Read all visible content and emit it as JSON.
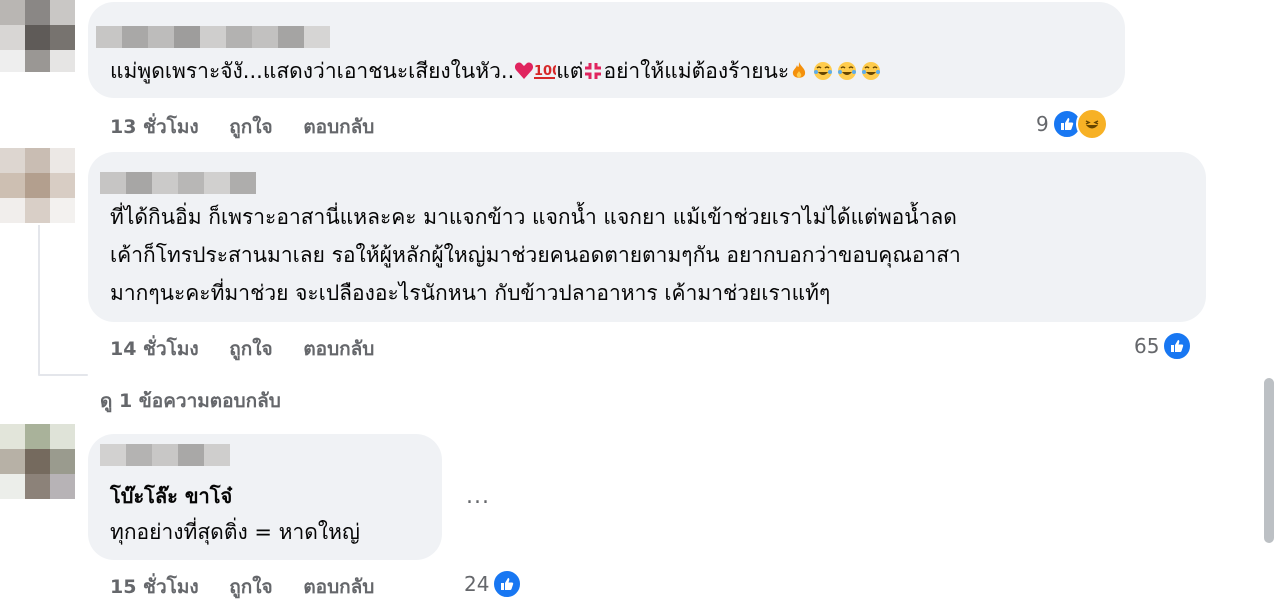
{
  "colors": {
    "bubble": "#f0f2f5",
    "meta_text": "#65676b",
    "like_blue": "#1877f2",
    "haha_yellow": "#f7b125"
  },
  "comments": [
    {
      "text_line_1": "แม่พูดเพราะจังั...แสดงว่าเอาชนะเสียงในหัว..",
      "text_mid": "แต่",
      "text_line_1_end": "อย่าให้แม่ต้องร้ายนะ",
      "time": "13 ชั่วโมง",
      "like": "ถูกใจ",
      "reply": "ตอบกลับ",
      "reaction_count": "9",
      "reaction_icons": [
        "like-icon",
        "haha-icon"
      ]
    },
    {
      "lines": [
        "ที่ได้กินอิ่ม ก็เพราะอาสานี่แหละคะ มาแจกข้าว แจกน้ำ แจกยา แม้เข้าช่วยเราไม่ได้แต่พอน้ำลด",
        "เค้าก็โทรประสานมาเลย รอให้ผู้หลักผู้ใหญ่มาช่วยคนอดตายตามๆกัน อยากบอกว่าขอบคุณอาสา",
        "มากๆนะคะที่มาช่วย จะเปลืองอะไรนักหนา กับข้าวปลาอาหาร เค้ามาช่วยเราแท้ๆ"
      ],
      "time": "14 ชั่วโมง",
      "like": "ถูกใจ",
      "reply": "ตอบกลับ",
      "reaction_count": "65",
      "reaction_icons": [
        "like-icon"
      ],
      "view_replies": "ดู 1 ข้อความตอบกลับ"
    },
    {
      "tag": "โบ๊ะโล๊ะ ขาโจ๋",
      "text": "ทุกอย่างที่สุดติ่ง = หาดใหญ่",
      "time": "15 ชั่วโมง",
      "like": "ถูกใจ",
      "reply": "ตอบกลับ",
      "reaction_count": "24",
      "reaction_icons": [
        "like-icon"
      ],
      "more_label": "..."
    }
  ]
}
